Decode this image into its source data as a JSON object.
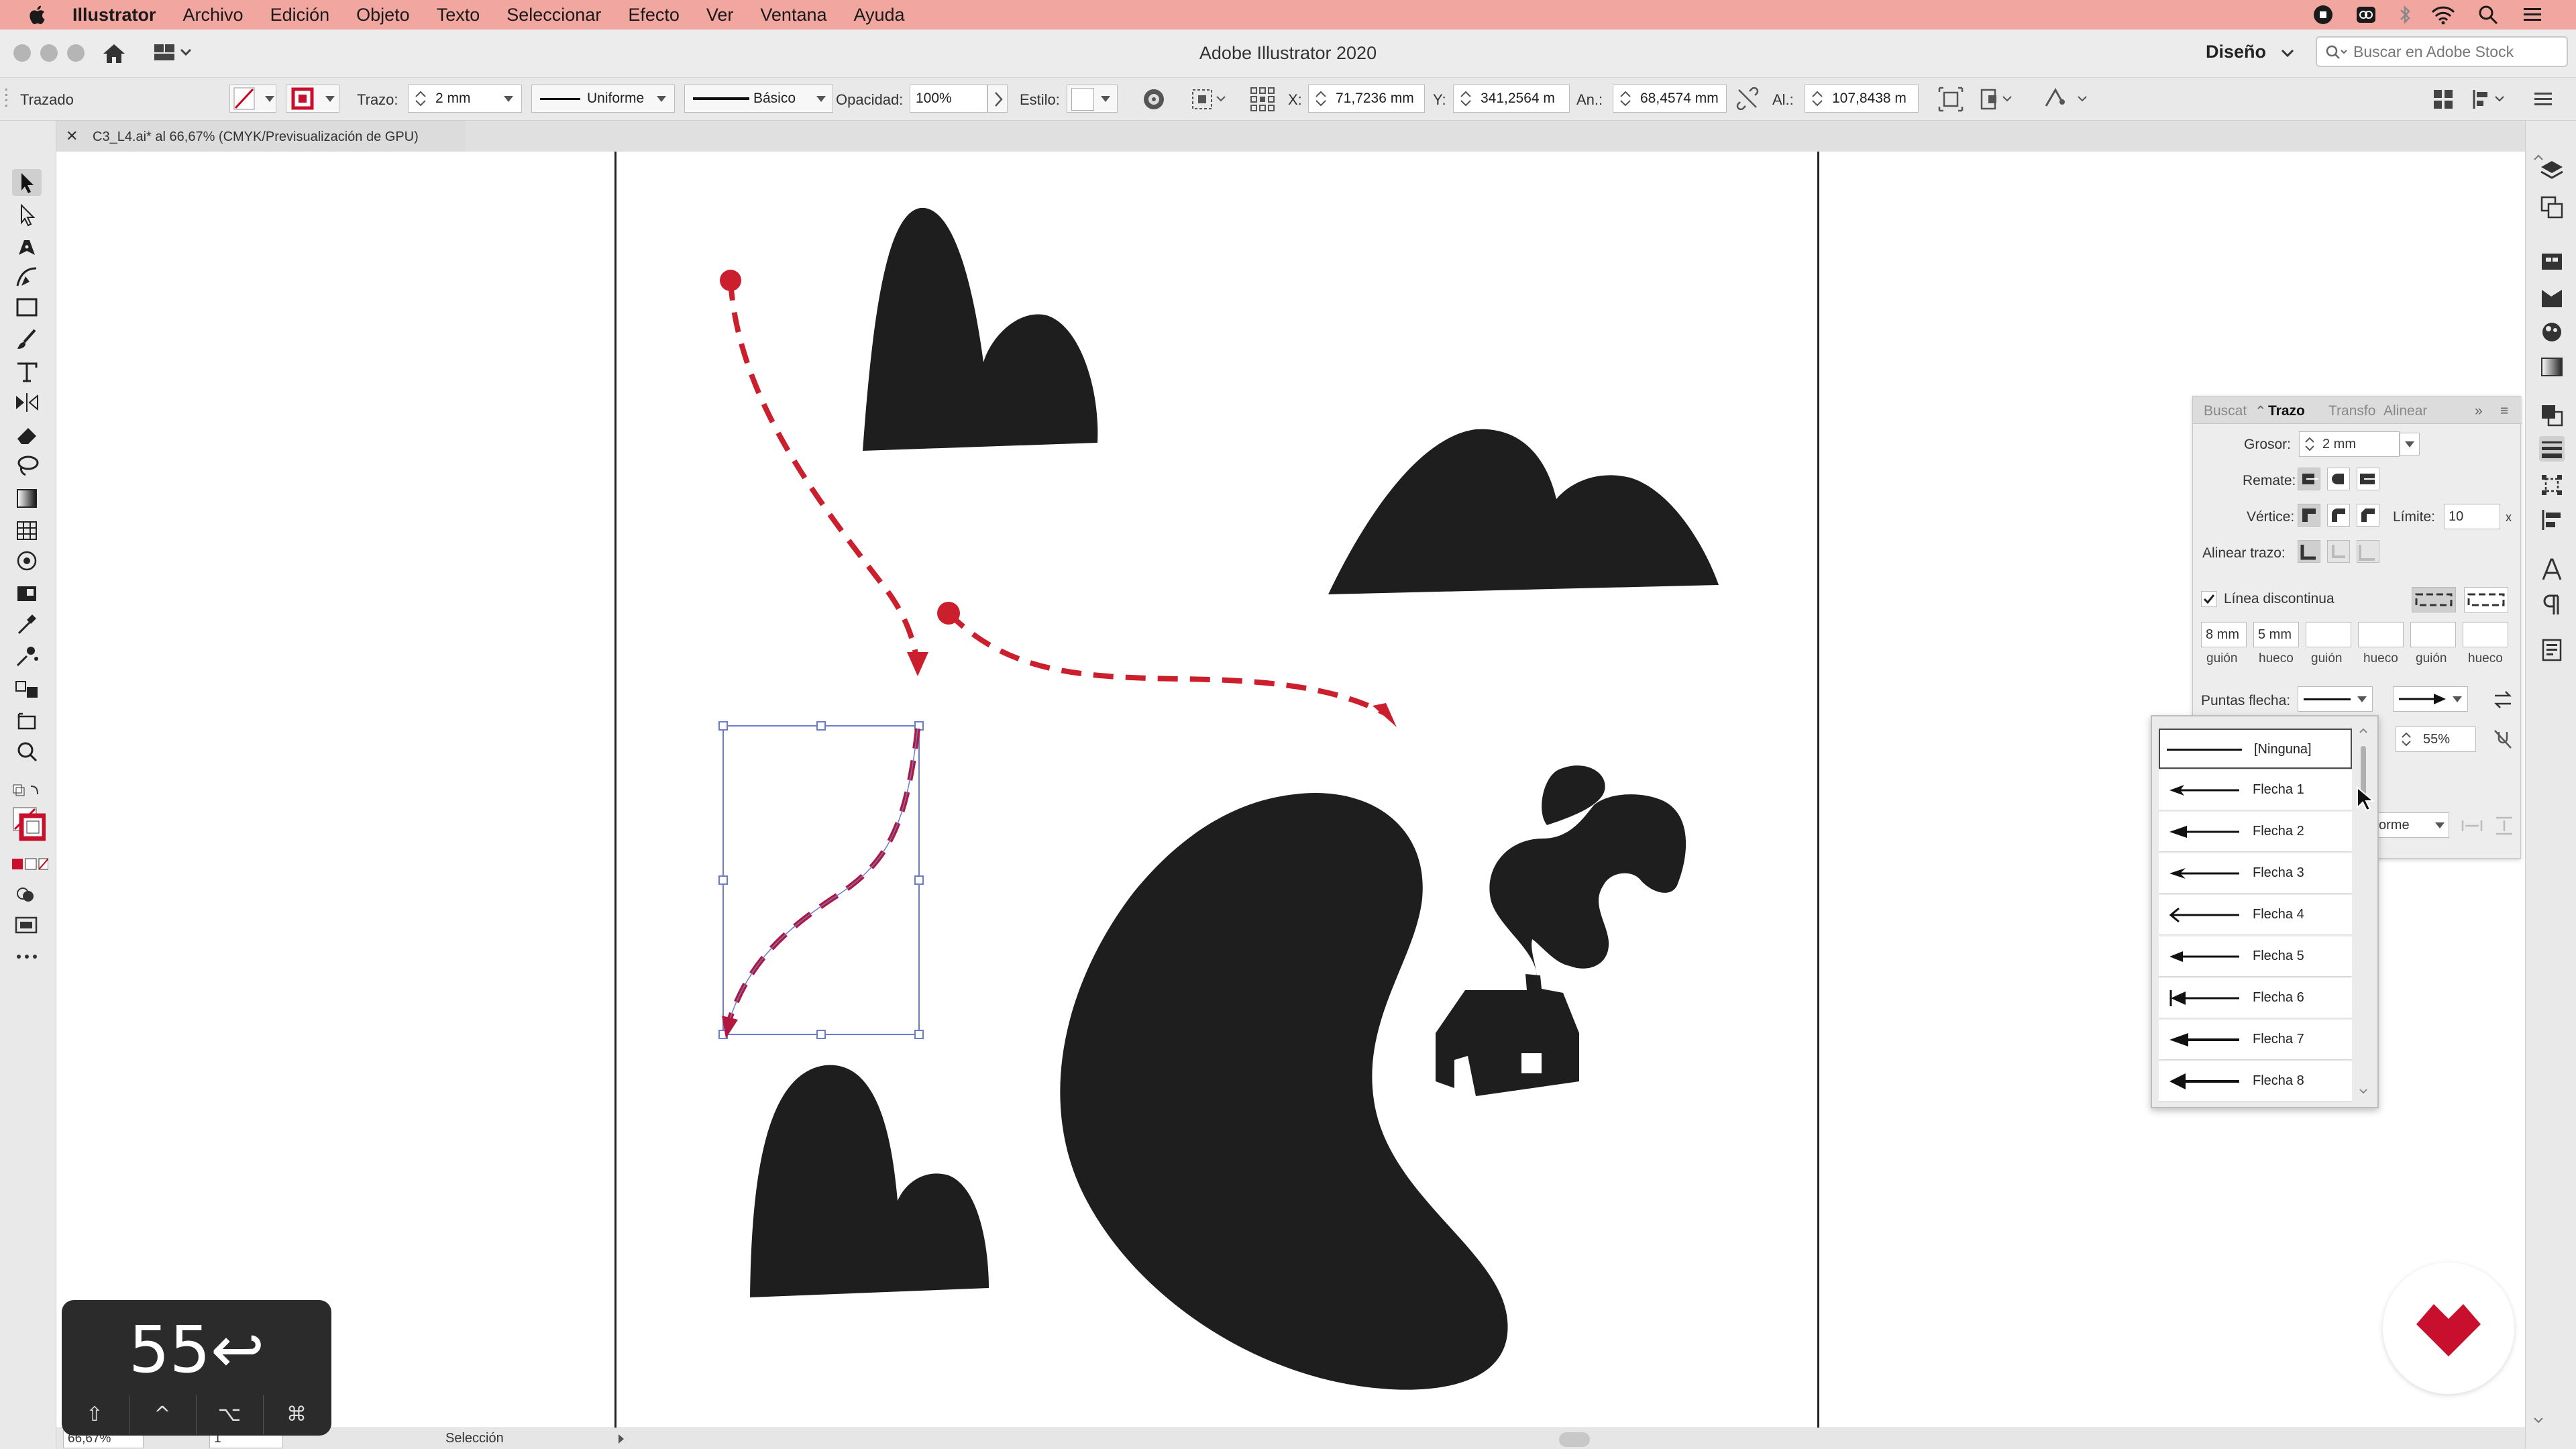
{
  "menubar": {
    "app": "Illustrator",
    "items": [
      "Archivo",
      "Edición",
      "Objeto",
      "Texto",
      "Seleccionar",
      "Efecto",
      "Ver",
      "Ventana",
      "Ayuda"
    ]
  },
  "window": {
    "title": "Adobe Illustrator 2020",
    "workspace": "Diseño",
    "stock_placeholder": "Buscar en Adobe Stock"
  },
  "control": {
    "object_type": "Trazado",
    "stroke_label": "Trazo:",
    "stroke_value": "2 mm",
    "profile": "Uniforme",
    "brush": "Básico",
    "opacity_label": "Opacidad:",
    "opacity_value": "100%",
    "style_label": "Estilo:",
    "x_label": "X:",
    "x_value": "71,7236 mm",
    "y_label": "Y:",
    "y_value": "341,2564 m",
    "w_label": "An.:",
    "w_value": "68,4574 mm",
    "h_label": "Al.:",
    "h_value": "107,8438 m"
  },
  "doc_tab": {
    "name": "C3_L4.ai* al 66,67% (CMYK/Previsualización de GPU)"
  },
  "stroke_panel": {
    "tabs": [
      "Buscat",
      "Trazo",
      "Transfo",
      "Alinear"
    ],
    "grosor_label": "Grosor:",
    "grosor_value": "2 mm",
    "remate_label": "Remate:",
    "vertice_label": "Vértice:",
    "limite_label": "Límite:",
    "limite_value": "10",
    "limite_unit": "x",
    "alinear_label": "Alinear trazo:",
    "dashed_label": "Línea discontinua",
    "dashed_checked": true,
    "dash_fields": [
      {
        "value": "8 mm",
        "label": "guión"
      },
      {
        "value": "5 mm",
        "label": "hueco"
      },
      {
        "value": "",
        "label": "guión"
      },
      {
        "value": "",
        "label": "hueco"
      },
      {
        "value": "",
        "label": "guión"
      },
      {
        "value": "",
        "label": "hueco"
      }
    ],
    "puntas_label": "Puntas flecha:",
    "escala_value": "55%",
    "perfil_value": "orme"
  },
  "arrow_list": {
    "items": [
      "[Ninguna]",
      "Flecha 1",
      "Flecha 2",
      "Flecha 3",
      "Flecha 4",
      "Flecha 5",
      "Flecha 6",
      "Flecha 7",
      "Flecha 8"
    ],
    "selected": 0
  },
  "status": {
    "zoom": "66,67%",
    "page": "1",
    "tool": "Selección"
  },
  "overlay": {
    "key_text": "55↩",
    "mods": [
      "⇧",
      "^",
      "⌥",
      "⌘"
    ]
  },
  "colors": {
    "menubar": "#f2a6a0",
    "accent_red": "#cc1f2e",
    "shapes": "#1e1e1e",
    "selection": "#4a61c9"
  }
}
